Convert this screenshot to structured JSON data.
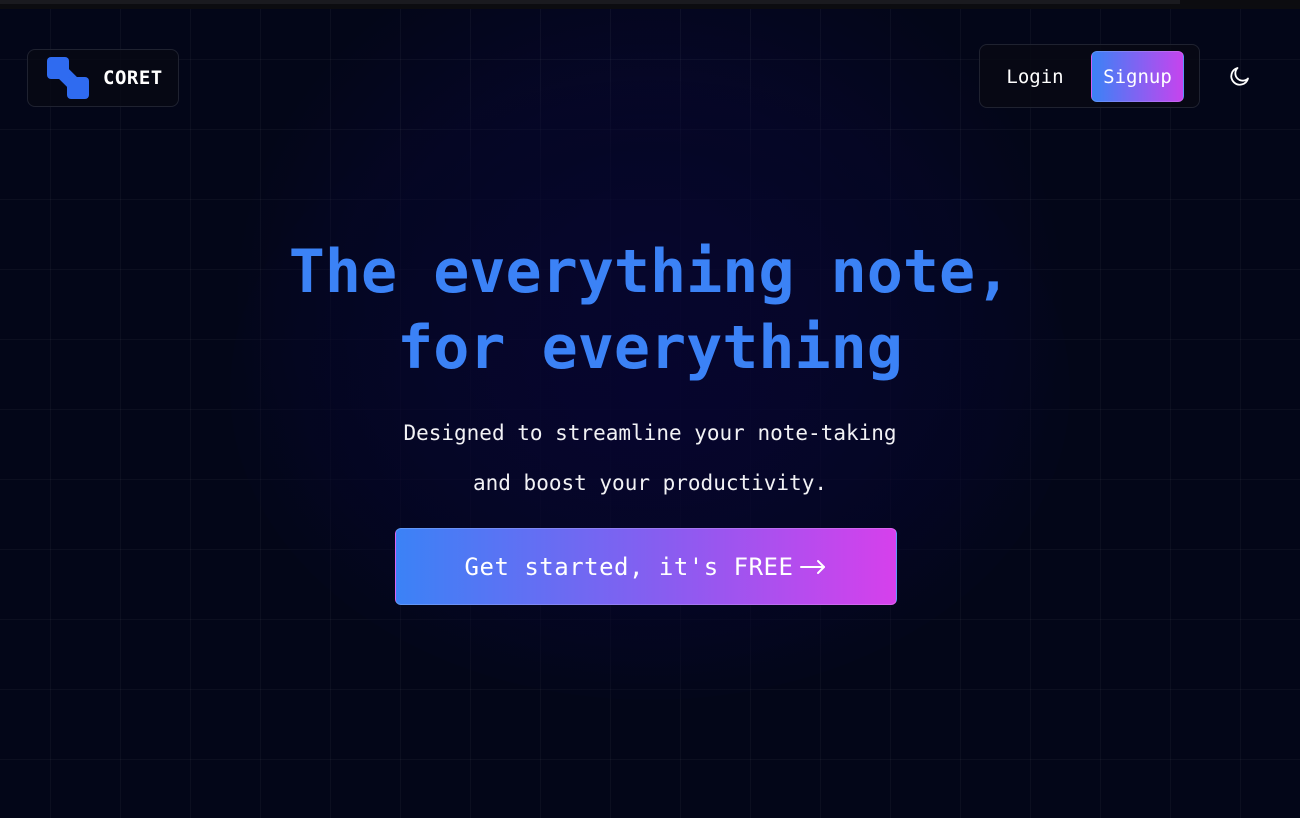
{
  "brand": {
    "name": "CORET",
    "logo_icon": "coret-logo-icon",
    "accent": "#2f6bf0"
  },
  "nav": {
    "login_label": "Login",
    "signup_label": "Signup",
    "theme_icon": "moon-icon"
  },
  "hero": {
    "headline_line1": "The everything note,",
    "headline_line2": "for everything",
    "subtitle_line1": "Designed to streamline your note-taking",
    "subtitle_line2": "and boost your productivity.",
    "cta_label": "Get started, it's FREE",
    "cta_icon": "arrow-right-icon",
    "headline_color": "#3b82f6",
    "gradient_start": "#3b82f6",
    "gradient_end": "#d640ec"
  }
}
